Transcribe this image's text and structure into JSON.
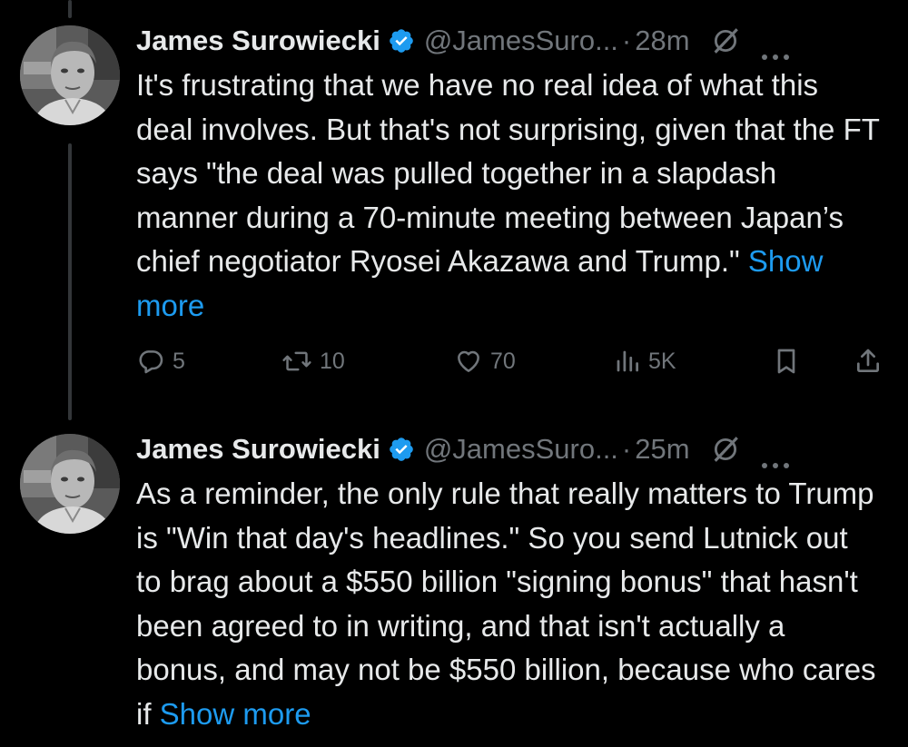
{
  "tweets": [
    {
      "author_name": "James Surowiecki",
      "handle": "@JamesSuro...",
      "separator": "·",
      "time": "28m",
      "text": "It's frustrating that we have no real idea of what this deal involves. But that's not surprising, given that the FT says \"the deal was pulled together in a slapdash manner during a 70-minute meeting between Japan’s chief negotiator Ryosei Akazawa and Trump.\" ",
      "show_more": "Show more",
      "replies": "5",
      "retweets": "10",
      "likes": "70",
      "views": "5K"
    },
    {
      "author_name": "James Surowiecki",
      "handle": "@JamesSuro...",
      "separator": "·",
      "time": "25m",
      "text": "As a reminder, the only rule that really matters to Trump is \"Win that day's headlines.\" So you send Lutnick out to brag about a $550 billion \"signing bonus\" that hasn't been agreed to in writing, and that isn't actually a bonus, and may not be $550 billion, because who cares if ",
      "show_more": "Show more"
    }
  ],
  "icons": {
    "verified": "verified-badge-icon",
    "grok": "grok-icon",
    "more": "more-options-icon",
    "reply": "reply-icon",
    "retweet": "retweet-icon",
    "like": "like-icon",
    "views": "views-icon",
    "bookmark": "bookmark-icon",
    "share": "share-icon"
  },
  "colors": {
    "background": "#000000",
    "text": "#e7e9ea",
    "muted": "#71767b",
    "link": "#1d9bf0",
    "thread_line": "#333639"
  }
}
